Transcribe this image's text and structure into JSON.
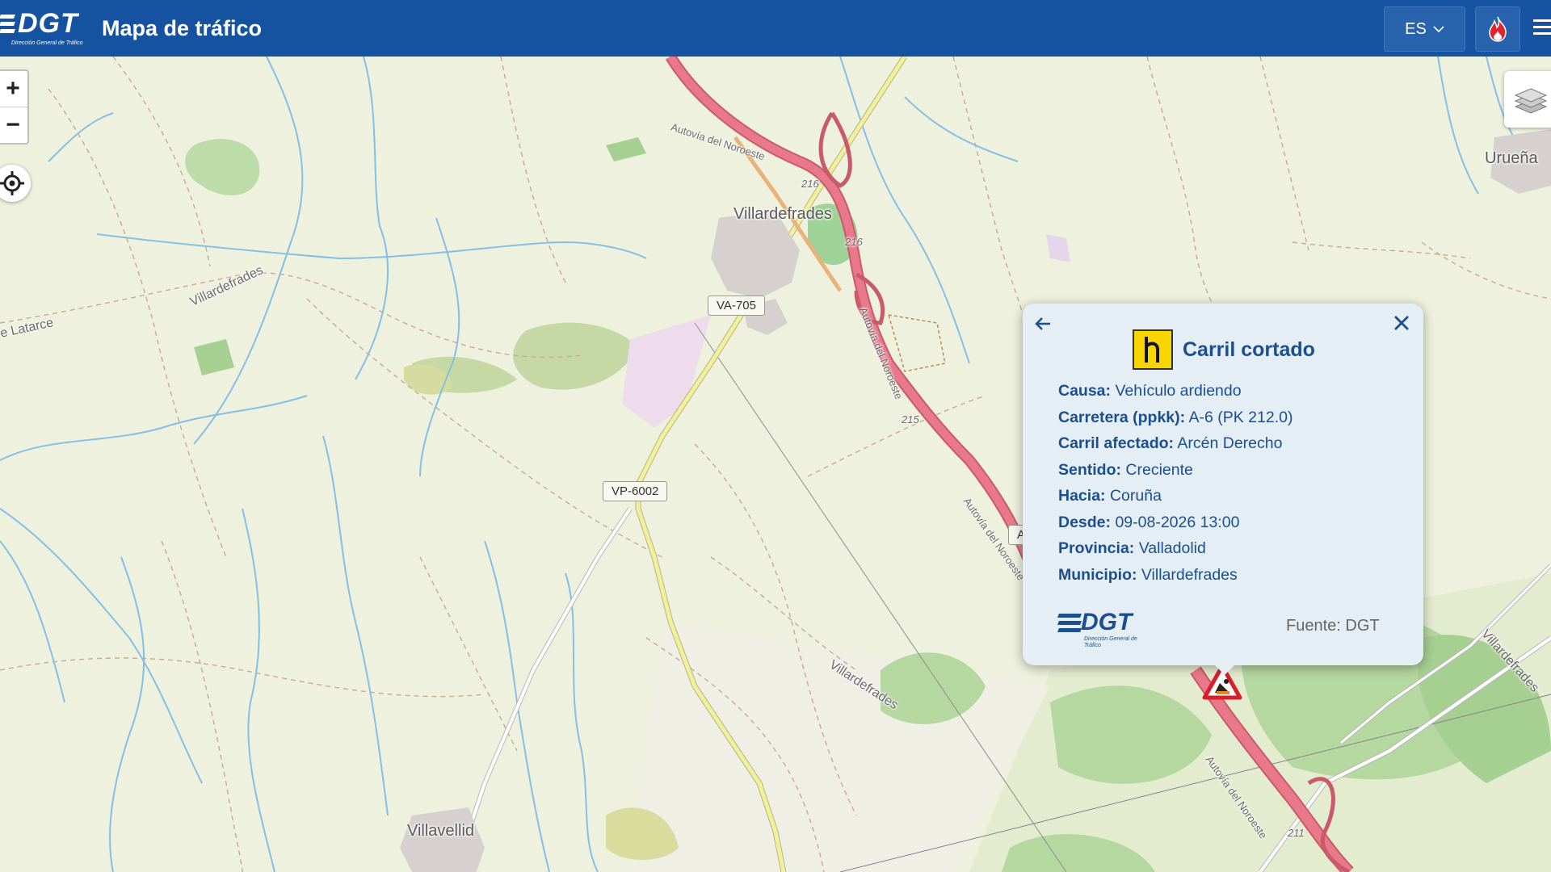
{
  "header": {
    "app_title": "Mapa de tráfico",
    "logo_text": "DGT",
    "logo_subtitle": "Dirección General de Tráfico",
    "language": "ES",
    "menu_icon": "hamburger-menu-icon",
    "fire_icon": "fire-icon",
    "colors": {
      "bar": "#1552a0",
      "button": "#2a63ad",
      "fire": "#e0242c"
    }
  },
  "map_controls": {
    "zoom_in": "+",
    "zoom_out": "−",
    "locate_icon": "crosshair-icon",
    "layers_icon": "layers-icon"
  },
  "map": {
    "places": {
      "villardefrades": "Villardefrades",
      "villavellid": "Villavellid",
      "uruena": "Urueña",
      "latarce": "e Latarce"
    },
    "area_labels": {
      "villardefrades_w": "Villardefrades",
      "villardefrades_s": "Villardefrades",
      "villardefrades_e": "Villardefrades"
    },
    "road_names": {
      "autovia_1": "Autovía del Noroeste",
      "autovia_2": "Autovía del Noroeste",
      "autovia_3": "Autovía del Noroeste",
      "autovia_4": "Autovía del Noroeste"
    },
    "km_markers": {
      "k216a": "216",
      "k216b": "216",
      "k215": "215",
      "k211": "211"
    },
    "shields": {
      "va705": "VA-705",
      "vp6002": "VP-6002",
      "a_partial": "A"
    },
    "incident_marker_icon": "roadwork-warning-icon",
    "colors": {
      "highway": "#e0687a",
      "secondary": "#f3f09a",
      "water": "#7ab8e0",
      "forest": "#b8d8a0"
    }
  },
  "popup": {
    "title": "Carril cortado",
    "sign_icon": "lane-closed-sign-icon",
    "back_icon": "arrow-left-icon",
    "close_icon": "close-icon",
    "fields": [
      {
        "label": "Causa:",
        "value": "Vehículo ardiendo"
      },
      {
        "label": "Carretera (ppkk):",
        "value": "A-6 (PK 212.0)"
      },
      {
        "label": "Carril afectado:",
        "value": "Arcén Derecho"
      },
      {
        "label": "Sentido:",
        "value": "Creciente"
      },
      {
        "label": "Hacia:",
        "value": "Coruña"
      },
      {
        "label": "Desde:",
        "value": "09-08-2026 13:00"
      },
      {
        "label": "Provincia:",
        "value": "Valladolid"
      },
      {
        "label": "Municipio:",
        "value": "Villardefrades"
      }
    ],
    "source_logo": "DGT",
    "source_logo_subtitle": "Dirección General de Tráfico",
    "source": "Fuente: DGT"
  }
}
